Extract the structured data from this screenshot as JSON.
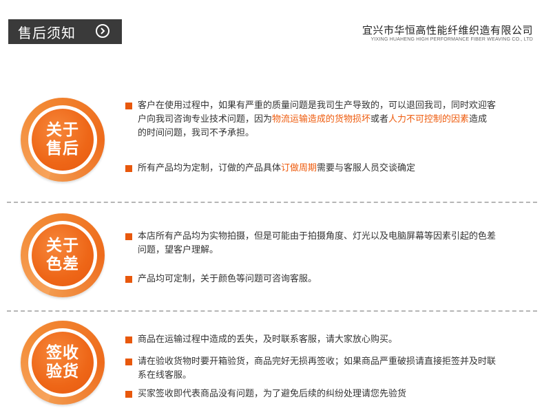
{
  "header": {
    "title": "售后须知",
    "company_cn": "宜兴市华恒高性能纤维织造有限公司",
    "company_en": "YIXING HUAHENG HIGH PERFORMANCE FIBER WEAVING CO., LTD"
  },
  "sections": [
    {
      "badge": [
        "关于",
        "售后"
      ],
      "items": [
        {
          "parts": [
            "客户在使用过程中，如果有严重的质量问题是我司生产导致的，可以退回我司，同时欢迎客户向我司咨询专业技术问题，因为",
            "物流运输造成的货物损坏",
            "或者",
            "人力不可控制的因素",
            "造成的时间问题，我司不予承担。"
          ]
        },
        {
          "parts": [
            "所有产品均为定制，订做的产品具体",
            "订做周期",
            "需要与客服人员交谈确定"
          ]
        }
      ]
    },
    {
      "badge": [
        "关于",
        "色差"
      ],
      "items": [
        {
          "text": "本店所有产品均为实物拍摄，但是可能由于拍摄角度、灯光以及电脑屏幕等因素引起的色差问题，望客户理解。"
        },
        {
          "text": "产品均可定制，关于颜色等问题可咨询客服。"
        }
      ]
    },
    {
      "badge": [
        "签收",
        "验货"
      ],
      "items": [
        {
          "text": "商品在运输过程中造成的丢失，及时联系客服，请大家放心购买。"
        },
        {
          "text": "请在验收货物时要开箱验货，商品完好无损再签收；如果商品严重破损请直接拒签并及时联系在线客服。"
        },
        {
          "text": "买家签收即代表商品没有问题，为了避免后续的纠纷处理请您先验货"
        }
      ]
    }
  ],
  "colors": {
    "accent": "#ee5b0d",
    "header_bg": "#3a3a3a",
    "divider": "#b5b5b5"
  }
}
